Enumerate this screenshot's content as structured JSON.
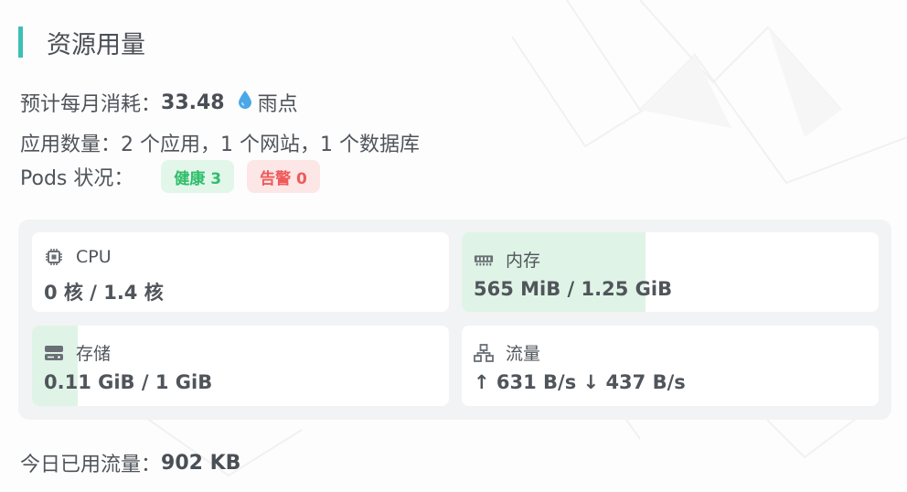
{
  "section": {
    "title": "资源用量"
  },
  "summary": {
    "monthly_label": "预计每月消耗：",
    "monthly_value": "33.48",
    "currency_unit": "雨点",
    "apps_label": "应用数量：",
    "apps_text": "2 个应用，1 个网站，1 个数据库",
    "pods_label": "Pods 状况：",
    "pods_healthy": "健康 3",
    "pods_warning": "告警 0"
  },
  "resources": {
    "cpu": {
      "label": "CPU",
      "value": "0 核 / 1.4 核",
      "usage_fraction": 0.0,
      "icon": "chip-icon"
    },
    "memory": {
      "label": "内存",
      "value": "565 MiB / 1.25 GiB",
      "usage_fraction": 0.441,
      "icon": "memory-icon"
    },
    "storage": {
      "label": "存储",
      "value": "0.11 GiB / 1 GiB",
      "usage_fraction": 0.11,
      "icon": "storage-icon"
    },
    "traffic": {
      "label": "流量",
      "value": "↑ 631 B/s ↓ 437 B/s",
      "icon": "network-icon"
    }
  },
  "footer": {
    "today_label": "今日已用流量：",
    "today_value": "902 KB"
  },
  "colors": {
    "accent_bar": "#3dbfb3",
    "usage_fill": "#dff4e6",
    "healthy_bg": "#e2f7ea",
    "healthy_text": "#2fbd6a",
    "warning_bg": "#fde6e6",
    "warning_text": "#f05a5a",
    "drop_icon": "#4aa8e8"
  }
}
